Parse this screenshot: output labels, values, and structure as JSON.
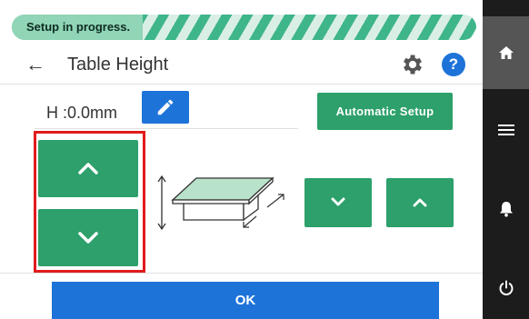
{
  "status": {
    "progress_label": "Setup in progress."
  },
  "header": {
    "title": "Table Height",
    "back_icon": "arrow-left-icon",
    "settings_icon": "gear-icon",
    "help_icon": "help-icon",
    "help_glyph": "?"
  },
  "height": {
    "label": "H",
    "separator": ":",
    "value": "0.0mm"
  },
  "buttons": {
    "automatic_setup": "Automatic Setup",
    "ok": "OK"
  },
  "sidebar": {
    "items": [
      "home-icon",
      "menu-icon",
      "bell-icon",
      "power-icon"
    ]
  },
  "colors": {
    "accent_green": "#2da06b",
    "accent_blue": "#1e73d8",
    "highlight_red": "#e01b1b",
    "sidebar_bg": "#1c1c1c"
  }
}
